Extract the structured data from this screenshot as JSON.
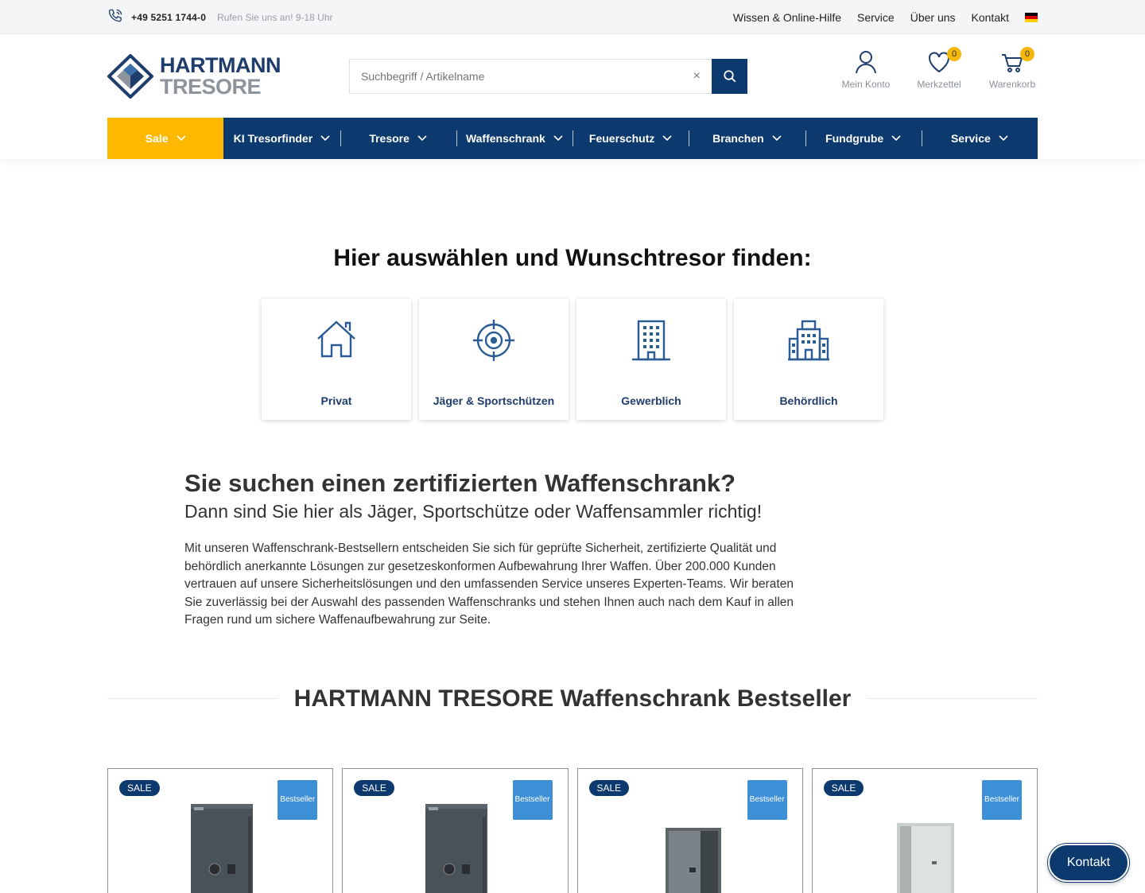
{
  "topbar": {
    "phone": "+49 5251 1744-0",
    "hours": "Rufen Sie uns an! 9-18 Uhr",
    "links": [
      "Wissen & Online-Hilfe",
      "Service",
      "Über uns",
      "Kontakt"
    ]
  },
  "logo": {
    "line1": "HARTMANN",
    "line2": "TRESORE"
  },
  "search": {
    "placeholder": "Suchbegriff / Artikelname",
    "clear": "×"
  },
  "header_icons": {
    "account": "Mein Konto",
    "wishlist": "Merkzettel",
    "wishlist_count": "0",
    "cart": "Warenkorb",
    "cart_count": "0"
  },
  "nav": [
    "Sale",
    "KI Tresorfinder",
    "Tresore",
    "Waffenschrank",
    "Feuerschutz",
    "Branchen",
    "Fundgrube",
    "Service"
  ],
  "finder": {
    "title": "Hier auswählen und Wunschtresor finden:",
    "cards": [
      "Privat",
      "Jäger & Sportschützen",
      "Gewerblich",
      "Behördlich"
    ]
  },
  "intro": {
    "heading": "Sie suchen einen zertifizierten Waffenschrank?",
    "subheading": "Dann sind Sie hier als Jäger, Sportschütze oder Waffensammler richtig!",
    "text": "Mit unseren Waffenschrank-Bestsellern entscheiden Sie sich für geprüfte Sicherheit, zertifizierte Qualität und behördlich anerkannte Lösungen zur gesetzeskonformen Aufbewahrung Ihrer Waffen. Über 200.000 Kunden vertrauen auf unsere Sicherheitslösungen und den umfassenden Service unseres Experten-Teams. Wir beraten Sie zuverlässig bei der Auswahl des passenden Waffenschranks und stehen Ihnen auch nach dem Kauf in allen Fragen rund um sichere Waffenaufbewahrung zur Seite."
  },
  "bestseller": {
    "title": "HARTMANN TRESORE Waffenschrank Bestseller",
    "products": [
      {
        "sale": "SALE",
        "badge": "Bestseller"
      },
      {
        "sale": "SALE",
        "badge": "Bestseller"
      },
      {
        "sale": "SALE",
        "badge": "Bestseller"
      },
      {
        "sale": "SALE",
        "badge": "Bestseller"
      }
    ]
  },
  "kontakt_button": "Kontakt",
  "colors": {
    "brand": "#0d3a6e",
    "sale": "#ffb800",
    "bestseller": "#3d8fd6",
    "badge": "#f5b80a"
  }
}
